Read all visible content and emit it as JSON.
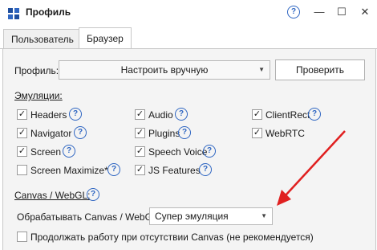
{
  "window": {
    "title": "Профиль",
    "controls": {
      "minimize": "—",
      "maximize": "☐",
      "close": "✕"
    },
    "help": "?"
  },
  "tabs": [
    {
      "label": "Пользователь",
      "active": false
    },
    {
      "label": "Браузер",
      "active": true
    }
  ],
  "profile": {
    "label": "Профиль:",
    "value": "Настроить вручную",
    "check_button": "Проверить"
  },
  "emulations": {
    "header": "Эмуляции:",
    "items": [
      {
        "label": "Headers",
        "checked": true
      },
      {
        "label": "Navigator",
        "checked": true
      },
      {
        "label": "Screen",
        "checked": true
      },
      {
        "label": "Screen Maximize*",
        "checked": false
      },
      {
        "label": "Audio",
        "checked": true
      },
      {
        "label": "Plugins",
        "checked": true
      },
      {
        "label": "Speech Voice",
        "checked": true
      },
      {
        "label": "JS Features",
        "checked": true
      },
      {
        "label": "ClientRect",
        "checked": true
      },
      {
        "label": "WebRTC",
        "checked": true
      }
    ]
  },
  "canvas": {
    "header": "Canvas / WebGL:",
    "process_label": "Обрабатывать Canvas / WebGL",
    "process_value": "Супер эмуляция",
    "continue_label": "Продолжать работу при отсутствии Canvas (не рекомендуется)",
    "continue_checked": false
  },
  "colors": {
    "accent": "#2f66c2",
    "annotation_arrow": "#e02020"
  }
}
